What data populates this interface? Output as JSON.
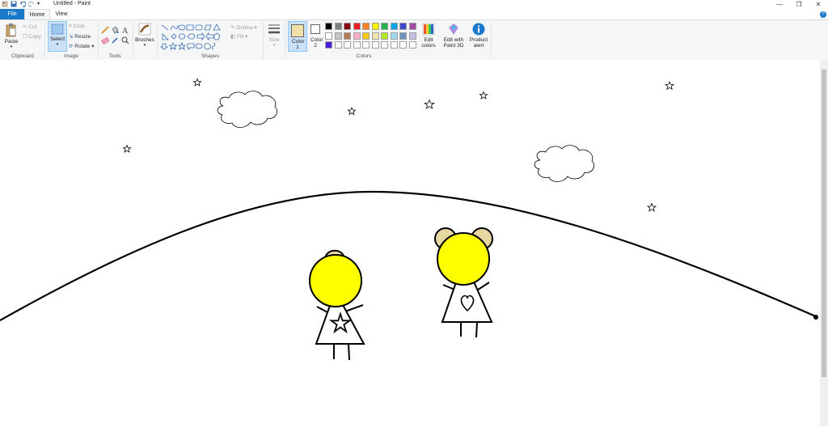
{
  "window": {
    "title": "Untitled - Paint",
    "minimize": "—",
    "maximize": "❐",
    "close": "✕"
  },
  "tabs": {
    "file": "File",
    "home": "Home",
    "view": "View"
  },
  "clipboard": {
    "paste": "Paste",
    "cut": "Cut",
    "copy": "Copy",
    "group": "Clipboard"
  },
  "image": {
    "select": "Select",
    "crop": "Crop",
    "resize": "Resize",
    "rotate": "Rotate",
    "group": "Image"
  },
  "tools": {
    "group": "Tools"
  },
  "brushes": {
    "label": "Brushes"
  },
  "shapes": {
    "outline": "Outline",
    "fill": "Fill",
    "group": "Shapes"
  },
  "size": {
    "label": "Size"
  },
  "colors": {
    "color1": "Color 1",
    "color2": "Color 2",
    "edit_colors": "Edit colors",
    "paint3d": "Edit with Paint 3D",
    "product_alert": "Product alert",
    "group": "Colors",
    "color1_value": "#f0e0a8",
    "color2_value": "#ffffff",
    "palette_row1": [
      "#000000",
      "#7f7f7f",
      "#880015",
      "#ed1c24",
      "#ff7f27",
      "#fff200",
      "#22b14c",
      "#00a2e8",
      "#3f48cc",
      "#a349a4"
    ],
    "palette_row2": [
      "#ffffff",
      "#c3c3c3",
      "#b97a57",
      "#ffaec9",
      "#ffc90e",
      "#efe4b0",
      "#b5e61d",
      "#99d9ea",
      "#7092be",
      "#c8bfe7"
    ],
    "palette_row3": [
      "#4a1fd6",
      "#ffffff",
      "#ffffff",
      "#ffffff",
      "#ffffff",
      "#ffffff",
      "#ffffff",
      "#ffffff",
      "#ffffff",
      "#ffffff"
    ]
  },
  "drawing": {
    "hair_color": "#e6d7a3",
    "head_color": "#ffff00",
    "stroke_color": "#000000"
  }
}
